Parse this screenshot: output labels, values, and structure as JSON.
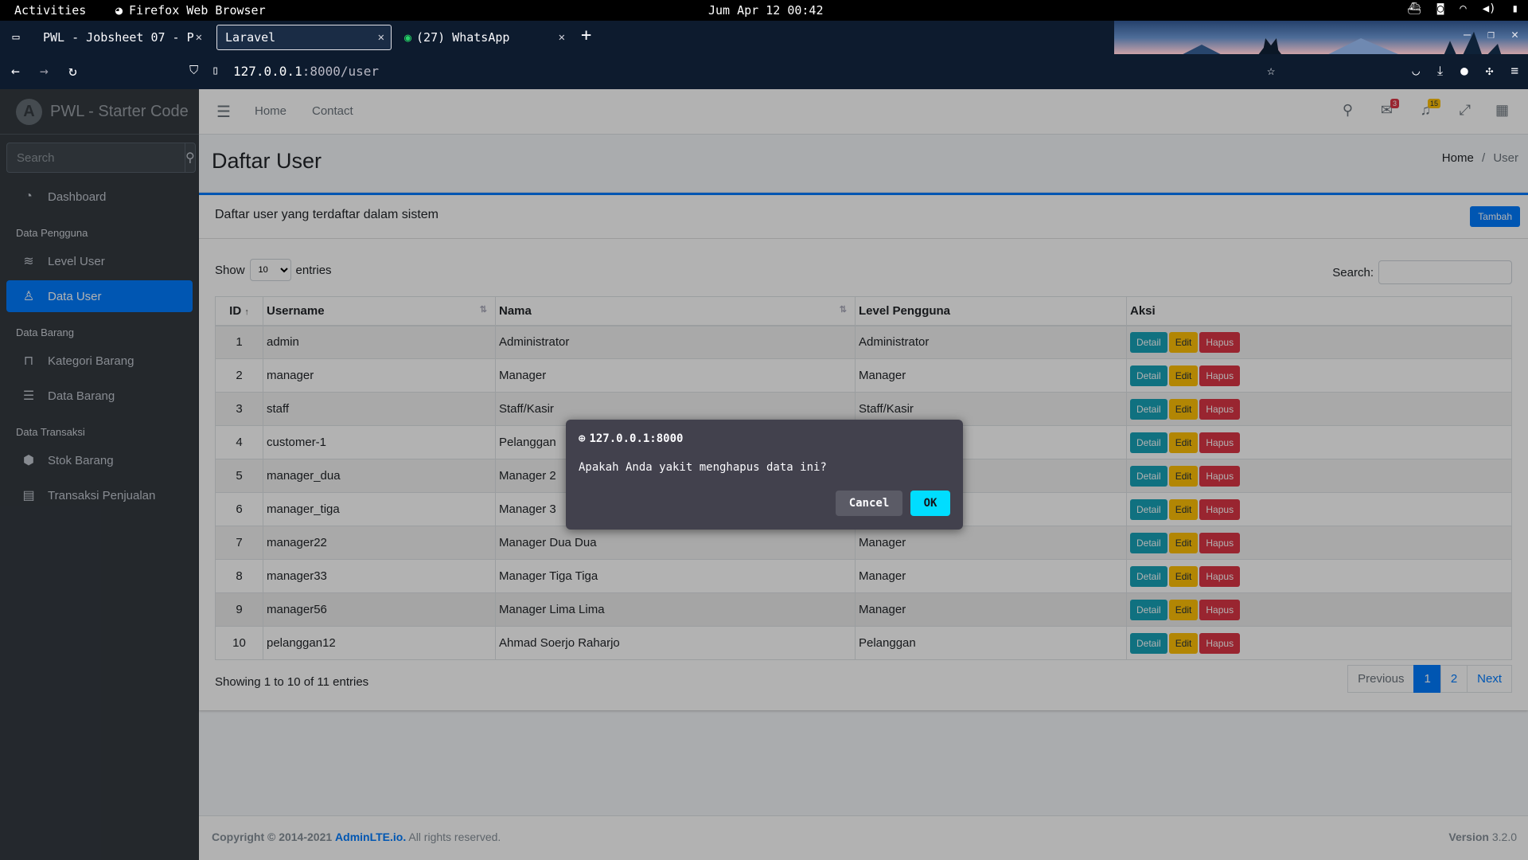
{
  "gnome": {
    "activities": "Activities",
    "app_name": "Firefox Web Browser",
    "clock": "Jum Apr 12 00:42"
  },
  "browser": {
    "tabs": [
      {
        "label": "PWL - Jobsheet 07 - P",
        "active": false
      },
      {
        "label": "Laravel",
        "active": true
      },
      {
        "label": "(27) WhatsApp",
        "active": false
      }
    ],
    "url_host": "127.0.0.1",
    "url_rest": ":8000/user"
  },
  "sidebar": {
    "brand": "PWL - Starter Code",
    "search_placeholder": "Search",
    "items": [
      {
        "type": "link",
        "label": "Dashboard",
        "icon": "dashboard-icon",
        "glyph": "◔"
      },
      {
        "type": "header",
        "label": "Data Pengguna"
      },
      {
        "type": "link",
        "label": "Level User",
        "icon": "layers-icon",
        "glyph": "≋"
      },
      {
        "type": "link",
        "label": "Data User",
        "icon": "user-icon",
        "glyph": "♙",
        "active": true
      },
      {
        "type": "header",
        "label": "Data Barang"
      },
      {
        "type": "link",
        "label": "Kategori Barang",
        "icon": "bookmark-icon",
        "glyph": "⊓"
      },
      {
        "type": "link",
        "label": "Data Barang",
        "icon": "list-icon",
        "glyph": "☰"
      },
      {
        "type": "header",
        "label": "Data Transaksi"
      },
      {
        "type": "link",
        "label": "Stok Barang",
        "icon": "cubes-icon",
        "glyph": "⬢"
      },
      {
        "type": "link",
        "label": "Transaksi Penjualan",
        "icon": "cash-register-icon",
        "glyph": "▤"
      }
    ]
  },
  "topnav": {
    "home": "Home",
    "contact": "Contact",
    "messages_badge": "3",
    "notifications_badge": "15"
  },
  "content": {
    "title": "Daftar User",
    "breadcrumb_home": "Home",
    "breadcrumb_sep": "/",
    "breadcrumb_current": "User"
  },
  "card": {
    "title": "Daftar user yang terdaftar dalam sistem",
    "add_button": "Tambah",
    "show_label": "Show",
    "entries_label": "entries",
    "length_value": "10",
    "search_label": "Search:",
    "columns": [
      "ID",
      "Username",
      "Nama",
      "Level Pengguna",
      "Aksi"
    ],
    "rows": [
      {
        "id": "1",
        "username": "admin",
        "nama": "Administrator",
        "level": "Administrator"
      },
      {
        "id": "2",
        "username": "manager",
        "nama": "Manager",
        "level": "Manager"
      },
      {
        "id": "3",
        "username": "staff",
        "nama": "Staff/Kasir",
        "level": "Staff/Kasir"
      },
      {
        "id": "4",
        "username": "customer-1",
        "nama": "Pelanggan",
        "level": ""
      },
      {
        "id": "5",
        "username": "manager_dua",
        "nama": "Manager 2",
        "level": ""
      },
      {
        "id": "6",
        "username": "manager_tiga",
        "nama": "Manager 3",
        "level": ""
      },
      {
        "id": "7",
        "username": "manager22",
        "nama": "Manager Dua Dua",
        "level": "Manager"
      },
      {
        "id": "8",
        "username": "manager33",
        "nama": "Manager Tiga Tiga",
        "level": "Manager"
      },
      {
        "id": "9",
        "username": "manager56",
        "nama": "Manager Lima Lima",
        "level": "Manager"
      },
      {
        "id": "10",
        "username": "pelanggan12",
        "nama": "Ahmad Soerjo Raharjo",
        "level": "Pelanggan"
      }
    ],
    "btn_detail": "Detail",
    "btn_edit": "Edit",
    "btn_hapus": "Hapus",
    "info": "Showing 1 to 10 of 11 entries",
    "pagination": {
      "previous": "Previous",
      "pages": [
        "1",
        "2"
      ],
      "current": "1",
      "next": "Next"
    }
  },
  "footer": {
    "copyright": "Copyright © 2014-2021",
    "link": "AdminLTE.io.",
    "rights": "All rights reserved.",
    "version_label": "Version",
    "version": "3.2.0"
  },
  "dialog": {
    "origin": "127.0.0.1:8000",
    "message": "Apakah Anda yakit menghapus data ini?",
    "cancel": "Cancel",
    "ok": "OK"
  },
  "colors": {
    "primary": "#007bff",
    "info": "#17a2b8",
    "warning": "#ffc107",
    "danger": "#dc3545",
    "sidebar": "#343a40",
    "dialog_ok": "#00ddff"
  }
}
